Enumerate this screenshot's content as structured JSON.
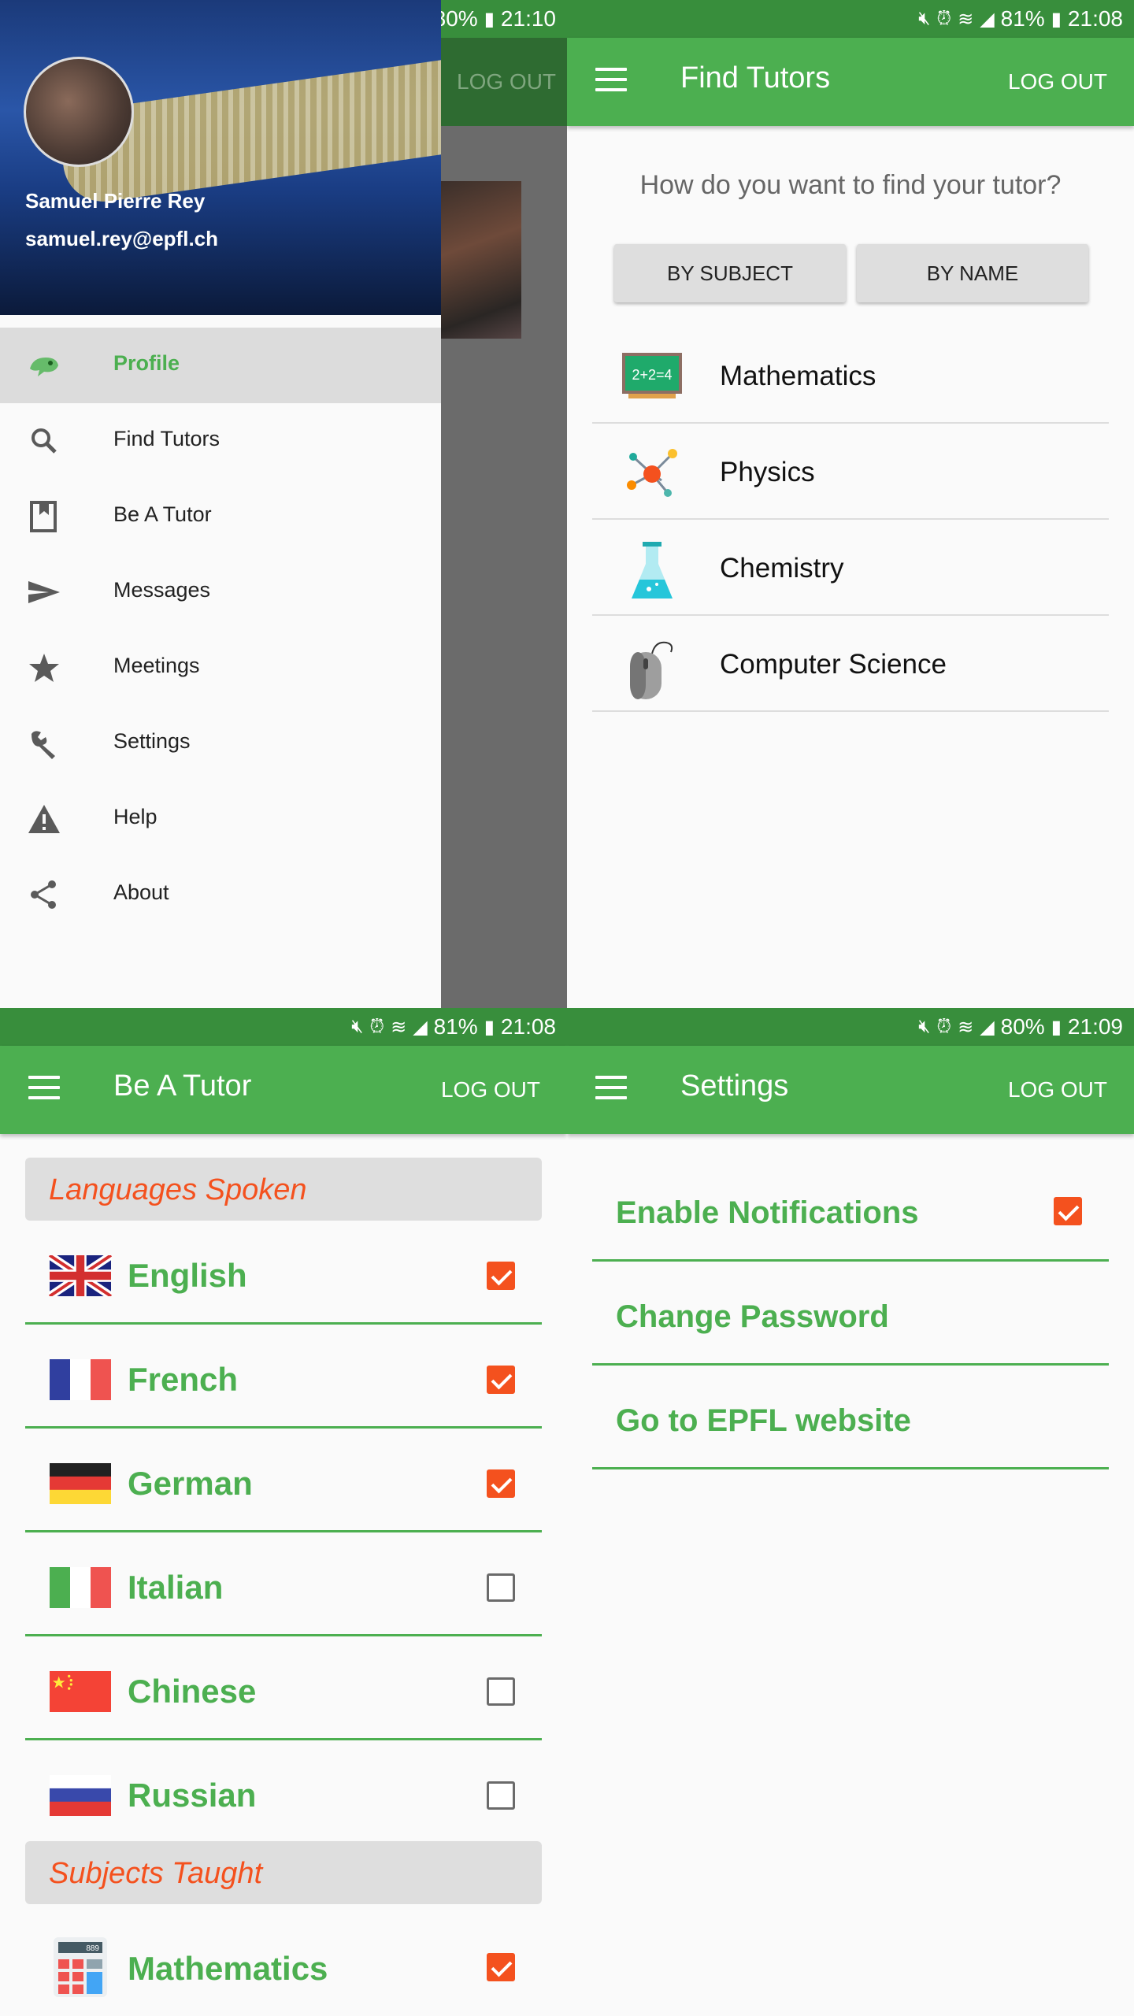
{
  "drawer_screen": {
    "status": {
      "battery": "80%",
      "time": "21:10"
    },
    "appbar_logout": "LOG OUT",
    "user": {
      "name": "Samuel Pierre Rey",
      "email": "samuel.rey@epfl.ch"
    },
    "items": [
      {
        "label": "Profile",
        "icon": "chameleon-icon",
        "active": true
      },
      {
        "label": "Find Tutors",
        "icon": "search-icon"
      },
      {
        "label": "Be A Tutor",
        "icon": "bookmark-icon"
      },
      {
        "label": "Messages",
        "icon": "send-icon"
      },
      {
        "label": "Meetings",
        "icon": "star-icon"
      },
      {
        "label": "Settings",
        "icon": "wrench-icon"
      },
      {
        "label": "Help",
        "icon": "warning-icon"
      },
      {
        "label": "About",
        "icon": "share-icon"
      }
    ]
  },
  "find_tutors": {
    "status": {
      "battery": "81%",
      "time": "21:08"
    },
    "title": "Find Tutors",
    "logout": "LOG OUT",
    "question": "How do you want to find your tutor?",
    "by_subject": "BY SUBJECT",
    "by_name": "BY NAME",
    "subjects": [
      {
        "label": "Mathematics",
        "icon": "chalkboard-icon"
      },
      {
        "label": "Physics",
        "icon": "molecule-icon"
      },
      {
        "label": "Chemistry",
        "icon": "flask-icon"
      },
      {
        "label": "Computer Science",
        "icon": "mouse-icon"
      }
    ],
    "chalkboard_text": "2+2=4"
  },
  "be_a_tutor": {
    "status": {
      "battery": "81%",
      "time": "21:08"
    },
    "title": "Be A Tutor",
    "logout": "LOG OUT",
    "languages_header": "Languages Spoken",
    "languages": [
      {
        "label": "English",
        "checked": true,
        "flag": "uk-flag-icon"
      },
      {
        "label": "French",
        "checked": true,
        "flag": "france-flag-icon"
      },
      {
        "label": "German",
        "checked": true,
        "flag": "germany-flag-icon"
      },
      {
        "label": "Italian",
        "checked": false,
        "flag": "italy-flag-icon"
      },
      {
        "label": "Chinese",
        "checked": false,
        "flag": "china-flag-icon"
      },
      {
        "label": "Russian",
        "checked": false,
        "flag": "russia-flag-icon"
      }
    ],
    "subjects_header": "Subjects Taught",
    "subjects": [
      {
        "label": "Mathematics",
        "checked": true,
        "icon": "calculator-icon"
      }
    ],
    "calculator_display": "889"
  },
  "settings": {
    "status": {
      "battery": "80%",
      "time": "21:09"
    },
    "title": "Settings",
    "logout": "LOG OUT",
    "rows": [
      {
        "label": "Enable Notifications",
        "checkbox": true,
        "checked": true
      },
      {
        "label": "Change Password"
      },
      {
        "label": "Go to EPFL website"
      }
    ]
  },
  "colors": {
    "primary": "#4caf50",
    "primary_dark": "#388e3c",
    "accent": "#f4511e"
  }
}
